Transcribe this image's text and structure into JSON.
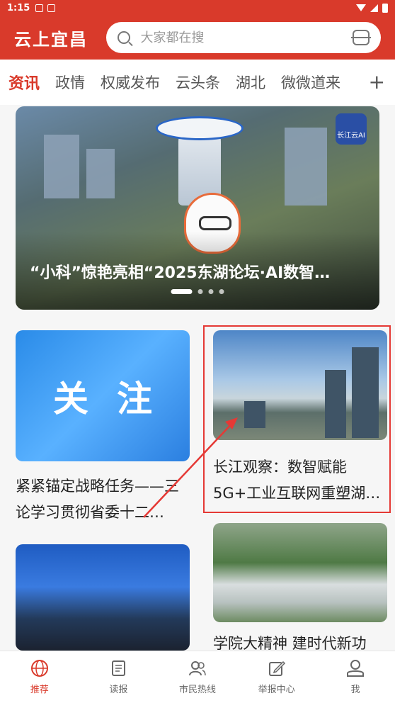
{
  "status_bar": {
    "time": "1:15"
  },
  "header": {
    "title": "云上宜昌",
    "search_placeholder": "大家都在搜"
  },
  "tabs": [
    "资讯",
    "政情",
    "权威发布",
    "云头条",
    "湖北",
    "微微道来"
  ],
  "banner": {
    "caption": "“小科”惊艳亮相“2025东湖论坛·AI数智…",
    "active_dot": 0,
    "dot_count": 4,
    "logo_text": "长江云AI"
  },
  "cards": [
    {
      "image_text": "关注",
      "title": "紧紧锚定战略任务——三论学习贯彻省委十二…"
    },
    {
      "title": "长江观察：数智赋能5G+工业互联网重塑湖…"
    },
    {
      "title": ""
    },
    {
      "title": "学院大精神 建时代新功"
    }
  ],
  "bottom_nav": [
    {
      "label": "推荐",
      "icon": "globe-icon",
      "active": true
    },
    {
      "label": "读报",
      "icon": "newspaper-icon",
      "active": false
    },
    {
      "label": "市民热线",
      "icon": "people-icon",
      "active": false
    },
    {
      "label": "举报中心",
      "icon": "edit-icon",
      "active": false
    },
    {
      "label": "我",
      "icon": "user-icon",
      "active": false
    }
  ],
  "colors": {
    "brand": "#d93a2b",
    "highlight": "#e53935"
  }
}
